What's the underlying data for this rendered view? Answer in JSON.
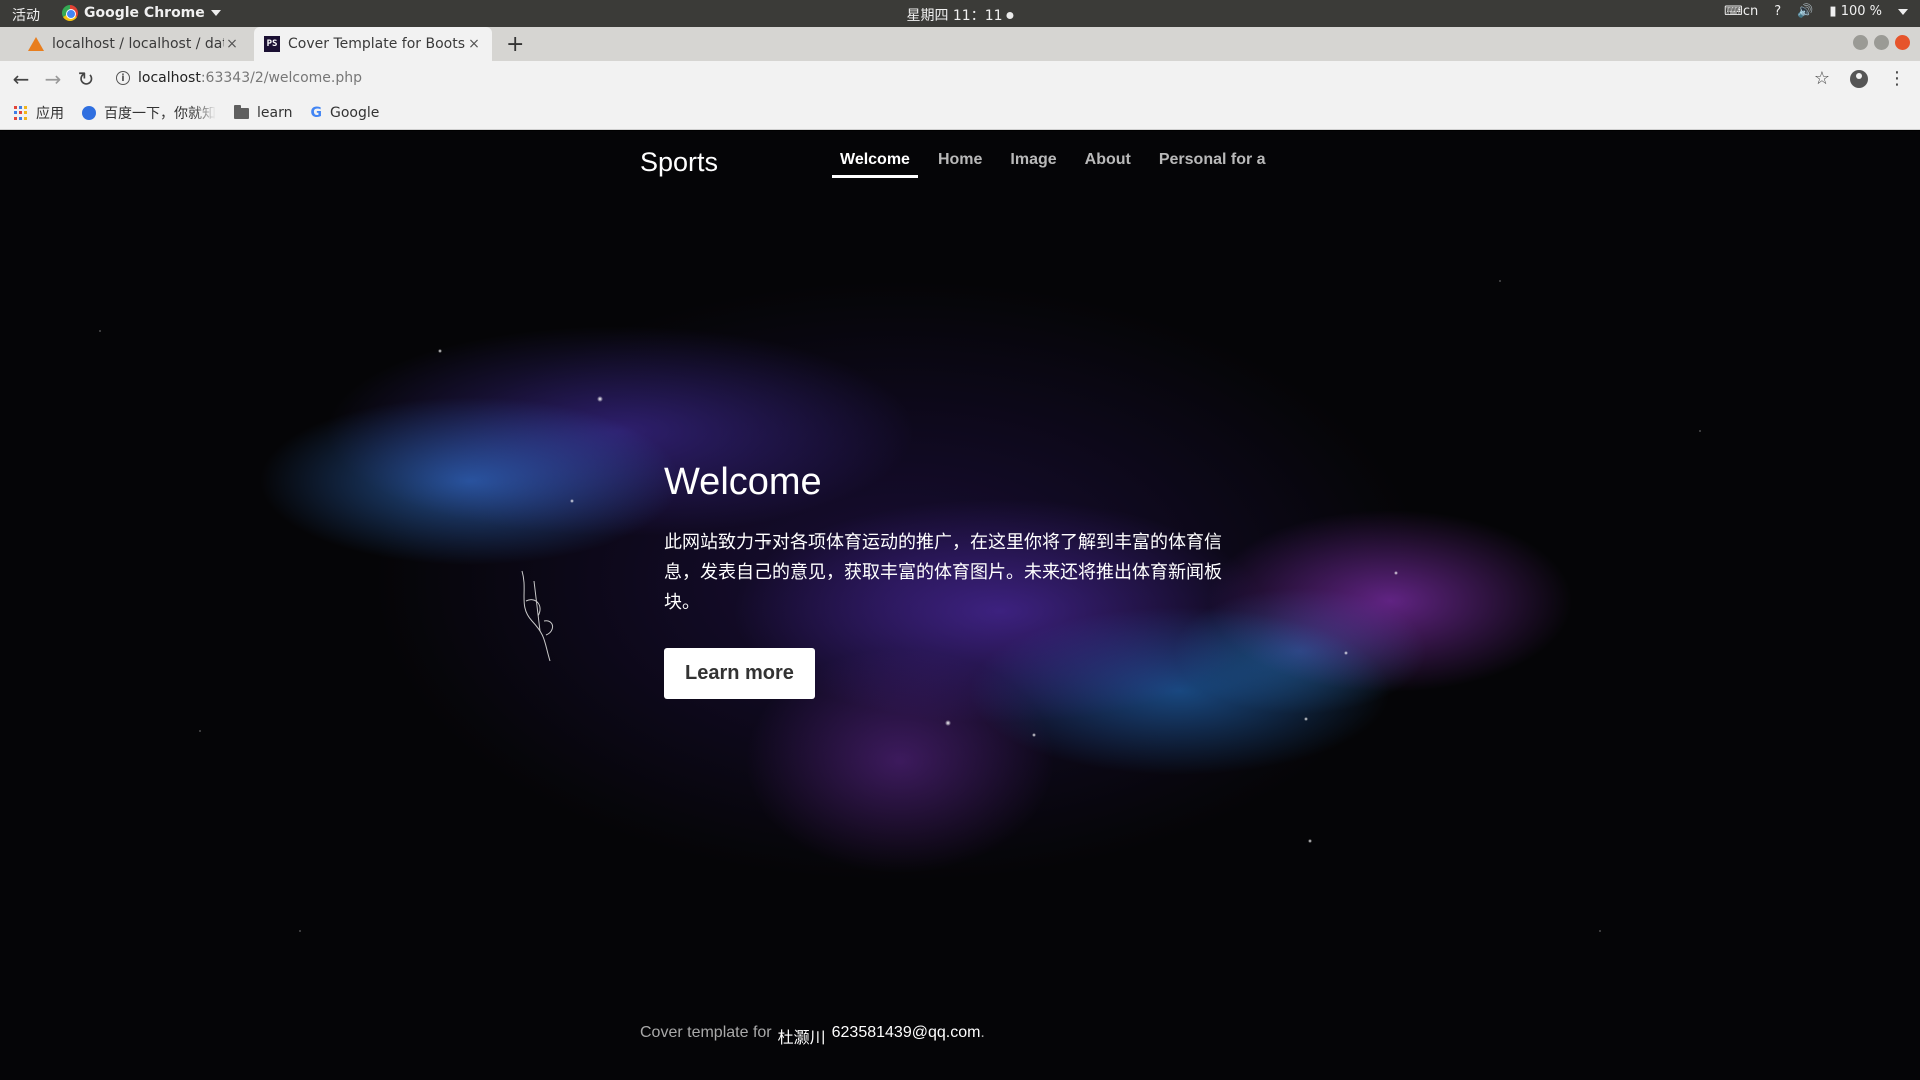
{
  "os_bar": {
    "activities": "活动",
    "app_name": "Google Chrome",
    "clock": "星期四 11：11",
    "input_method": "cn",
    "help": "?",
    "battery": "100 %"
  },
  "tabs": [
    {
      "title": "localhost / localhost / dat",
      "close": "×"
    },
    {
      "title": "Cover Template for Boots",
      "close": "×"
    }
  ],
  "new_tab_symbol": "+",
  "address_bar": {
    "host": "localhost",
    "path": ":63343/2/welcome.php",
    "info_symbol": "i"
  },
  "bookmarks": [
    {
      "label": "应用",
      "icon": "apps-icon"
    },
    {
      "label": "百度一下，你就知道",
      "icon": "baidu-paw-icon"
    },
    {
      "label": "learn",
      "icon": "folder-icon"
    },
    {
      "label": "Google",
      "icon": "google-icon"
    }
  ],
  "site": {
    "brand": "Sports",
    "nav": [
      "Welcome",
      "Home",
      "Image",
      "About",
      "Personal for a"
    ],
    "active_nav": "Welcome",
    "hero_title": "Welcome",
    "hero_text": "此网站致力于对各项体育运动的推广，在这里你将了解到丰富的体育信息，发表自己的意见，获取丰富的体育图片。未来还将推出体育新闻板块。",
    "button_label": "Learn more",
    "footer_prefix": "Cover template for",
    "footer_name": "杜灏川",
    "footer_email": "623581439@qq.com",
    "footer_suffix": "."
  },
  "colors": {
    "page_background": "#050507",
    "nebula_blue": "#3c8cff",
    "nebula_purple": "#aa3ce6",
    "nav_inactive": "#b9b9b9",
    "close_button": "#e6542b"
  }
}
